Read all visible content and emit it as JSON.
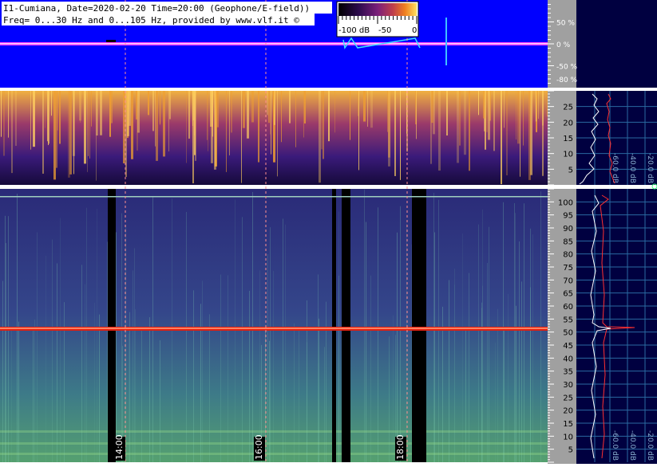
{
  "header": {
    "line1": "I1-Cumiana, Date=2020-02-20 Time=20:00 (Geophone/E-field))",
    "line2": "Freq= 0...30 Hz and 0...105 Hz, provided by www.vlf.it ©"
  },
  "colorbar": {
    "labels": [
      "-100 dB",
      "-50",
      "0"
    ],
    "range_db": [
      -100,
      0
    ],
    "colors": [
      "#000000",
      "#2a0a4a",
      "#7a1f7a",
      "#c0404a",
      "#f08020",
      "#ffe060"
    ]
  },
  "chart_data": [
    {
      "type": "line",
      "panel": "top-amplitude",
      "y_ticks": [
        "50 %",
        "0 %",
        "-50 %",
        "-80 %"
      ],
      "ylim": [
        -100,
        100
      ],
      "background": "#0000ff",
      "trace_color": "#ff40ff"
    },
    {
      "type": "heatmap",
      "panel": "spectrogram-0-30Hz",
      "y_ticks": [
        "25",
        "20",
        "15",
        "10",
        "5"
      ],
      "ylim": [
        0,
        30
      ],
      "colormap": "inferno"
    },
    {
      "type": "heatmap",
      "panel": "spectrogram-0-105Hz",
      "y_ticks": [
        "100",
        "95",
        "90",
        "85",
        "80",
        "75",
        "70",
        "65",
        "60",
        "55",
        "50",
        "45",
        "40",
        "35",
        "30",
        "25",
        "20",
        "15",
        "10",
        "5"
      ],
      "ylim": [
        0,
        105
      ],
      "colormap": "viridis-blue",
      "time_labels": [
        "14:00",
        "16:00",
        "18:00"
      ],
      "strong_line_hz": 50
    },
    {
      "type": "line",
      "panel": "spectrum-profile-upper",
      "x_ticks": [
        "-60.0 dB",
        "-40.0 dB",
        "-20.0 dB"
      ],
      "ylim": [
        0,
        30
      ]
    },
    {
      "type": "line",
      "panel": "spectrum-profile-lower",
      "x_ticks": [
        "-60.0 dB",
        "-40.0 dB",
        "-20.0 dB"
      ],
      "ylim": [
        0,
        105
      ],
      "peak_hz": 50
    }
  ]
}
